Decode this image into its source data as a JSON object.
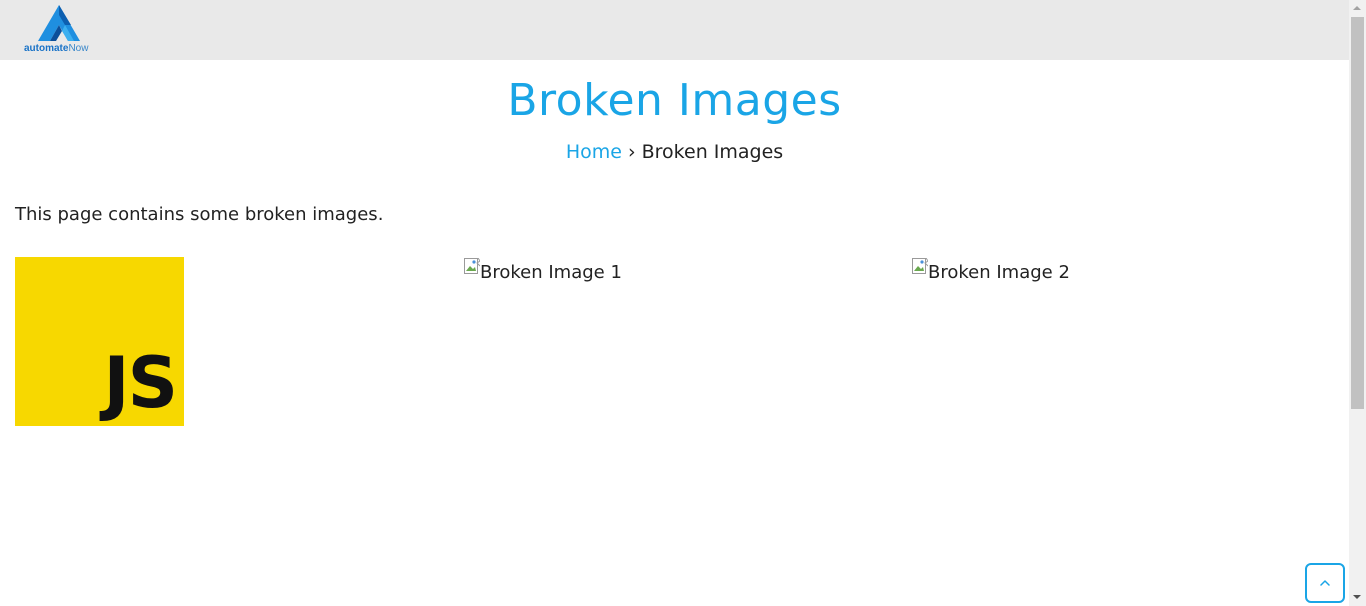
{
  "header": {
    "logo_word_bold": "automate",
    "logo_word_light": "Now"
  },
  "page": {
    "title": "Broken Images",
    "intro": "This page contains some broken images."
  },
  "breadcrumb": {
    "home": "Home",
    "separator": "›",
    "current": "Broken Images"
  },
  "images": {
    "js_logo_text": "JS",
    "broken_1_alt": "Broken Image 1",
    "broken_2_alt": "Broken Image 2"
  },
  "icons": {
    "logo": "automatenow-logo-icon",
    "broken_image": "broken-image-icon",
    "scroll_top": "chevron-up-icon"
  },
  "colors": {
    "accent": "#1aa5e6",
    "header_bg": "#e9e9e9",
    "js_yellow": "#f7d800",
    "text": "#222222"
  }
}
